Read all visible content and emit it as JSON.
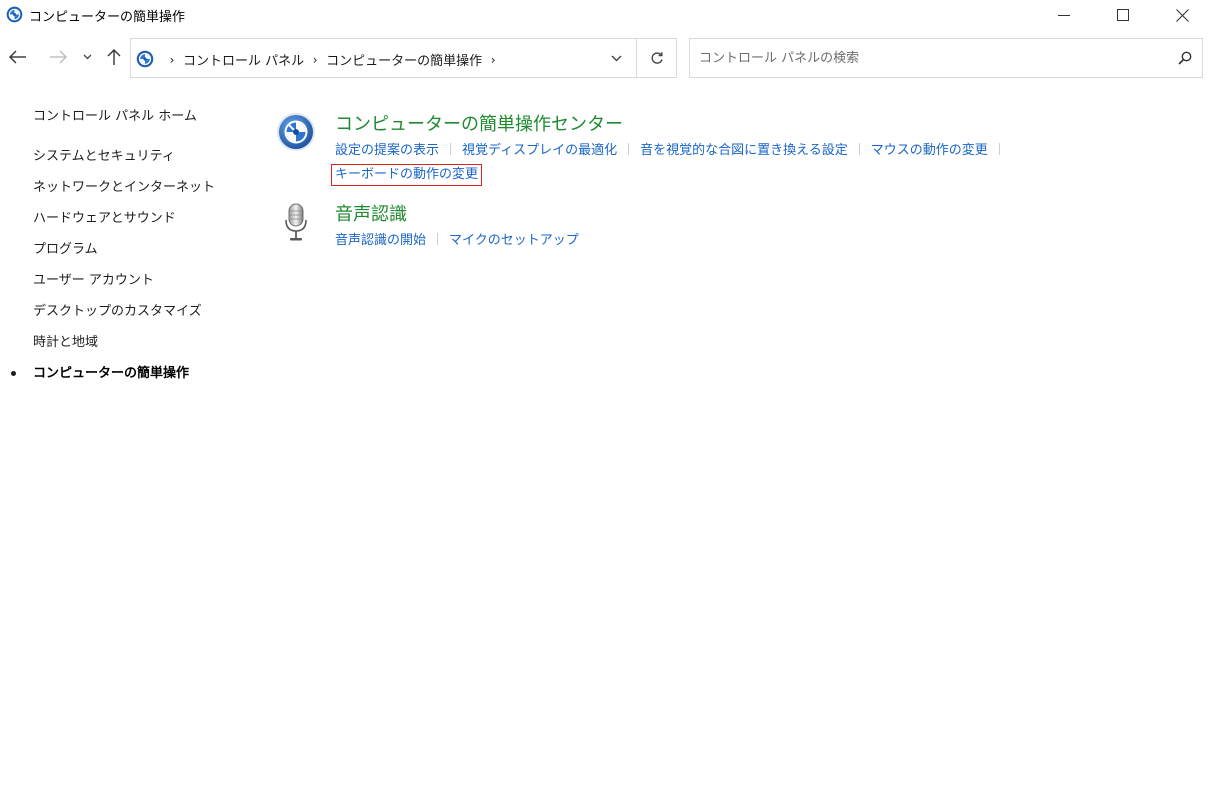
{
  "window": {
    "title": "コンピューターの簡単操作",
    "minimize_label": "最小化",
    "maximize_label": "最大化",
    "close_label": "閉じる"
  },
  "address": {
    "crumbs": [
      "コントロール パネル",
      "コンピューターの簡単操作"
    ]
  },
  "search": {
    "placeholder": "コントロール パネルの検索"
  },
  "sidebar": {
    "home": "コントロール パネル ホーム",
    "items": [
      {
        "label": "システムとセキュリティ"
      },
      {
        "label": "ネットワークとインターネット"
      },
      {
        "label": "ハードウェアとサウンド"
      },
      {
        "label": "プログラム"
      },
      {
        "label": "ユーザー アカウント"
      },
      {
        "label": "デスクトップのカスタマイズ"
      },
      {
        "label": "時計と地域"
      },
      {
        "label": "コンピューターの簡単操作"
      }
    ],
    "current_index": 7
  },
  "main": {
    "sections": [
      {
        "title": "コンピューターの簡単操作センター",
        "icon": "ease-of-access-icon",
        "links": [
          "設定の提案の表示",
          "視覚ディスプレイの最適化",
          "音を視覚的な合図に置き換える設定",
          "マウスの動作の変更",
          "キーボードの動作の変更"
        ],
        "highlighted_link_index": 4
      },
      {
        "title": "音声認識",
        "icon": "microphone-icon",
        "links": [
          "音声認識の開始",
          "マイクのセットアップ"
        ]
      }
    ]
  },
  "colors": {
    "title_green": "#1f8a2f",
    "link_blue": "#1a66c7",
    "highlight_red": "#e02424"
  }
}
